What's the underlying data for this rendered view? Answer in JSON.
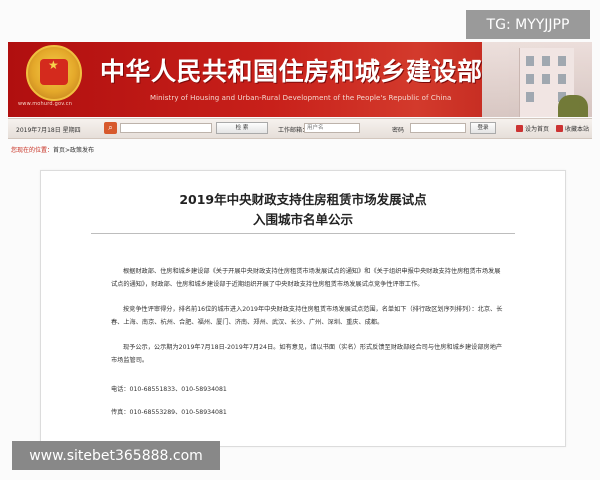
{
  "watermark_top": "TG: MYYJJPP",
  "watermark_bottom": "www.sitebet365888.com",
  "header": {
    "title": "中华人民共和国住房和城乡建设部",
    "subtitle": "Ministry of Housing and Urban-Rural Development of the People's Republic of China",
    "emblem_url": "www.mohurd.gov.cn"
  },
  "toolbar": {
    "date": "2019年7月18日 星期四",
    "search_button": "检  索",
    "email_label": "工作邮箱：",
    "username_placeholder": "用户名",
    "password_label": "密码",
    "login_button": "登录",
    "set_home": "设为首页",
    "add_favorite": "收藏本站"
  },
  "breadcrumb": {
    "label": "您现在的位置：",
    "path": "首页>政策发布"
  },
  "article": {
    "title_line1": "2019年中央财政支持住房租赁市场发展试点",
    "title_line2": "入围城市名单公示",
    "para1": "根据财政部、住房和城乡建设部《关于开展中央财政支持住房租赁市场发展试点的通知》和《关于组织申报中央财政支持住房租赁市场发展试点的通知》，财政部、住房和城乡建设部于近期组织开展了中央财政支持住房租赁市场发展试点竞争性评审工作。",
    "para2": "按竞争性评审得分，排名前16位的城市进入2019年中央财政支持住房租赁市场发展试点范围，名单如下（排行政区划序列排列）：北京、长春、上海、南京、杭州、合肥、福州、厦门、济南、郑州、武汉、长沙、广州、深圳、重庆、成都。",
    "para3": "现予公示，公示期为2019年7月18日-2019年7月24日。如有意见，请以书面（实名）形式反馈至财政部经合司与住房和城乡建设部房地产市场监管司。",
    "phone": "电话：010-68551833、010-58934081",
    "fax": "传真：010-68553289、010-58934081"
  }
}
